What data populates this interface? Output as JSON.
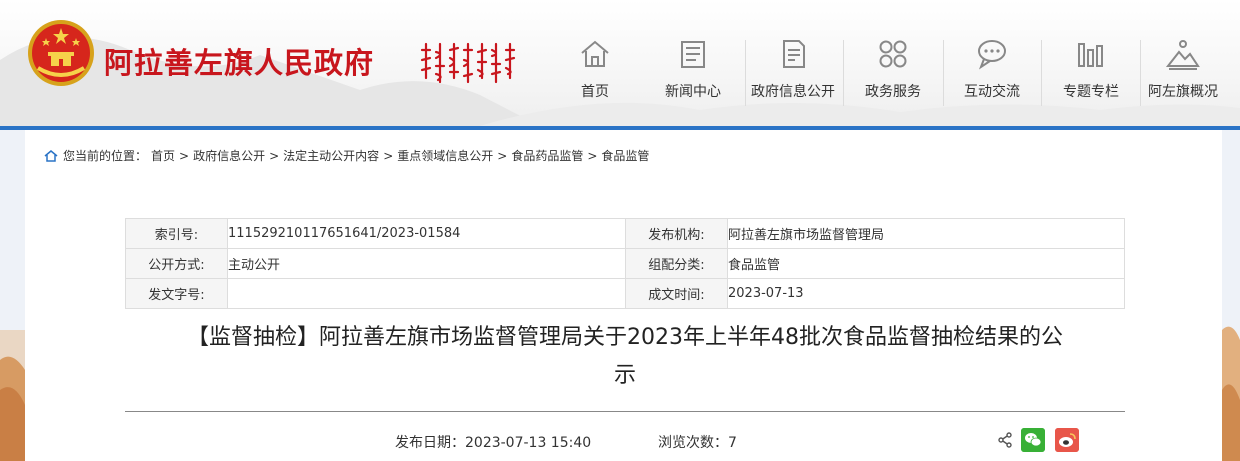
{
  "site": {
    "title": "阿拉善左旗人民政府"
  },
  "nav": [
    {
      "label": "首页",
      "icon": "home-icon"
    },
    {
      "label": "新闻中心",
      "icon": "news-icon"
    },
    {
      "label": "政府信息公开",
      "icon": "document-icon"
    },
    {
      "label": "政务服务",
      "icon": "grid-icon"
    },
    {
      "label": "互动交流",
      "icon": "chat-icon"
    },
    {
      "label": "专题专栏",
      "icon": "columns-icon"
    },
    {
      "label": "阿左旗概况",
      "icon": "mountain-icon"
    }
  ],
  "breadcrumb": {
    "prefix": "您当前的位置：",
    "items": [
      "首页",
      "政府信息公开",
      "法定主动公开内容",
      "重点领域信息公开",
      "食品药品监管",
      "食品监管"
    ],
    "separator": ">"
  },
  "meta": {
    "index_label": "索引号:",
    "index_value": "111529210117651641/2023-01584",
    "publisher_label": "发布机构:",
    "publisher_value": "阿拉善左旗市场监督管理局",
    "method_label": "公开方式:",
    "method_value": "主动公开",
    "category_label": "组配分类:",
    "category_value": "食品监管",
    "docno_label": "发文字号:",
    "docno_value": "",
    "date_label": "成文时间:",
    "date_value": "2023-07-13"
  },
  "article": {
    "title_line1": "【监督抽检】阿拉善左旗市场监督管理局关于2023年上半年48批次食品监督抽检结果的公",
    "title_line2": "示",
    "pub_date_label": "发布日期：",
    "pub_date_value": "2023-07-13 15:40",
    "views_label": "浏览次数：",
    "views_value": "7"
  },
  "colors": {
    "brand_red": "#c8161d",
    "bar_blue": "#2a73c6",
    "wechat_green": "#38b036",
    "weibo_red": "#e8564a"
  }
}
